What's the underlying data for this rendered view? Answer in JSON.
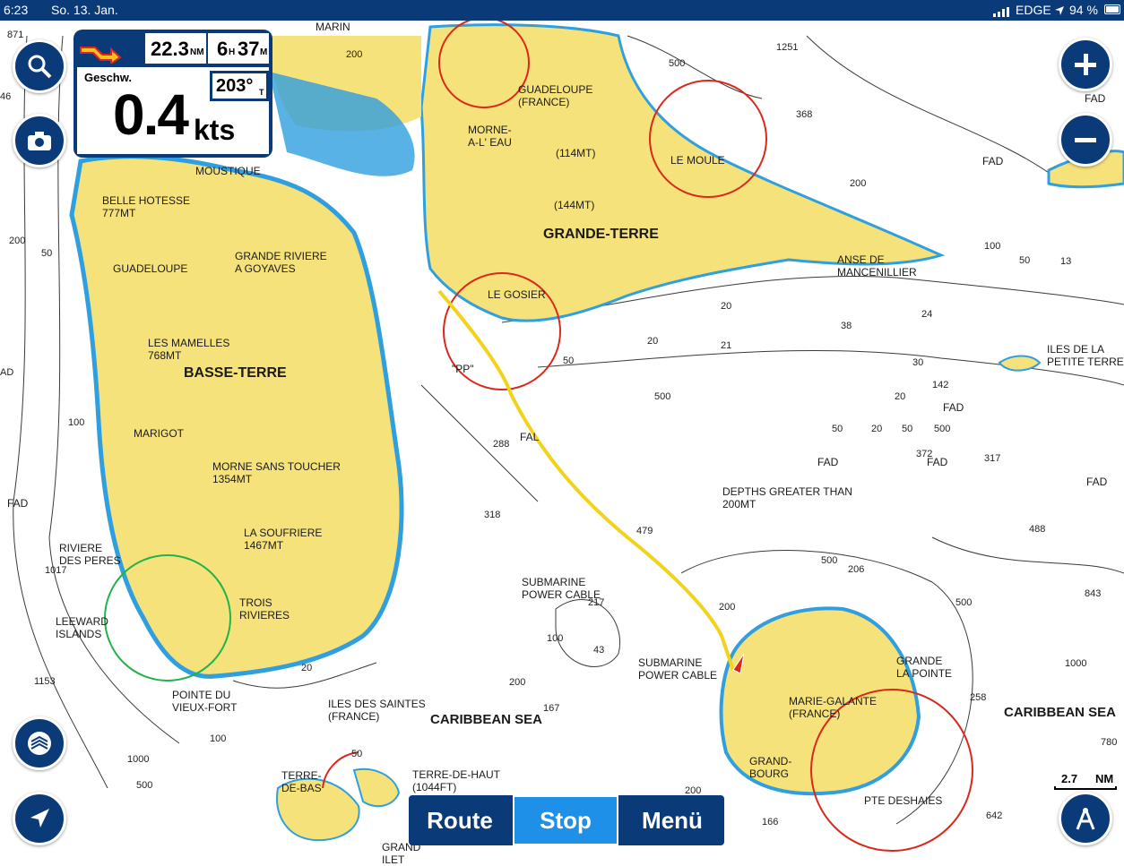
{
  "status": {
    "time": "6:23",
    "date": "So. 13. Jan.",
    "carrier": "EDGE",
    "battery": "94 %"
  },
  "nav_panel": {
    "distance_value": "22.3",
    "distance_unit": "NM",
    "eta_hours": "6",
    "eta_h_unit": "H",
    "eta_minutes": "37",
    "eta_m_unit": "M",
    "speed_label": "Geschw.",
    "speed_value": "0.4",
    "speed_unit": "kts",
    "heading_value": "203°",
    "heading_unit": "T"
  },
  "scale": {
    "value": "2.7",
    "unit": "NM"
  },
  "bottom_bar": {
    "route": "Route",
    "stop": "Stop",
    "menu": "Menü"
  },
  "colors": {
    "land": "#f6e27a",
    "shallow": "#2f9fe0",
    "route": "#f2d21a",
    "ui_blue": "#0b3a79"
  },
  "places": {
    "marin": "MARIN",
    "guadeloupe_france": "GUADELOUPE\n(FRANCE)",
    "morne_a_leau": "MORNE-\nA-L' EAU",
    "le_moule": "LE MOULE",
    "peak_114": "(114MT)",
    "peak_144": "(144MT)",
    "grande_terre": "GRANDE-TERRE",
    "moustique": "MOUSTIQUE",
    "belle_hotesse": "BELLE HOTESSE\n777MT",
    "grande_riviere": "GRANDE RIVIERE\nA GOYAVES",
    "guadeloupe": "GUADELOUPE",
    "le_gosier": "LE GOSIER",
    "anse_mancenillier": "ANSE DE\nMANCENILLIER",
    "les_mamelles": "LES MAMELLES\n768MT",
    "basse_terre": "BASSE-TERRE",
    "marigot": "MARIGOT",
    "morne_sans_toucher": "MORNE SANS TOUCHER\n1354MT",
    "la_soufriere": "LA SOUFRIERE\n1467MT",
    "riviere_des_peres": "RIVIERE\nDES PERES",
    "leeward_islands": "LEEWARD\nISLANDS",
    "trois_rivieres": "TROIS\nRIVIERES",
    "pointe_du_vieux_fort": "POINTE DU\nVIEUX-FORT",
    "iles_des_saintes": "ILES DES SAINTES\n(FRANCE)",
    "caribbean_sea": "CARIBBEAN SEA",
    "caribbean_sea_right": "CARIBBEAN SEA",
    "terre_de_bas": "TERRE-\nDE-BAS",
    "terre_de_haut": "TERRE-DE-HAUT\n(1044FT)",
    "grand_ilet": "GRAND\nILET",
    "submarine_cable_1": "SUBMARINE\nPOWER CABLE",
    "submarine_cable_2": "SUBMARINE\nPOWER CABLE",
    "depths_greater": "DEPTHS GREATER THAN\n200MT",
    "marie_galante": "MARIE-GALANTE\n(FRANCE)",
    "grand_bourg": "GRAND-\nBOURG",
    "grande_pointe": "GRANDE\nLA POINTE",
    "pte_deshaies": "PTE DESHAIES",
    "iles_de_la_petite_terre": "ILES DE LA\nPETITE TERRE",
    "pp": "\"PP\"",
    "fal": "FAL"
  },
  "fad": {
    "label": "FAD"
  },
  "depths": {
    "d871": "871",
    "d46": "46",
    "d200a": "200",
    "d500a": "500",
    "d1251": "1251",
    "d368": "368",
    "d200b": "200",
    "d100a": "100",
    "d50a": "50",
    "d13": "13",
    "d24": "24",
    "d20a": "20",
    "d21": "21",
    "d20b": "20",
    "d38": "38",
    "d30": "30",
    "d500b": "500",
    "d20c": "20",
    "d142": "142",
    "d288": "288",
    "d318": "318",
    "d479": "479",
    "d500c": "500",
    "d206": "206",
    "d843": "843",
    "d500d": "500",
    "d200c": "200",
    "d1000a": "1000",
    "d258": "258",
    "d780": "780",
    "d217": "217",
    "d100b": "100",
    "d43": "43",
    "d200d": "200",
    "d167": "167",
    "d1017": "1017",
    "d1153": "1153",
    "d100c": "100",
    "d1000b": "1000",
    "d500e": "500",
    "d50b": "50",
    "d200e": "200",
    "d642": "642",
    "d166": "166",
    "d317": "317",
    "d488": "488",
    "d500f": "500",
    "d372": "372",
    "d50c": "50",
    "d20d": "20",
    "d200f": "200",
    "d50d": "50",
    "d100d": "100",
    "d50e": "50",
    "d50f": "50",
    "d20e": "20",
    "dAD": "AD"
  }
}
